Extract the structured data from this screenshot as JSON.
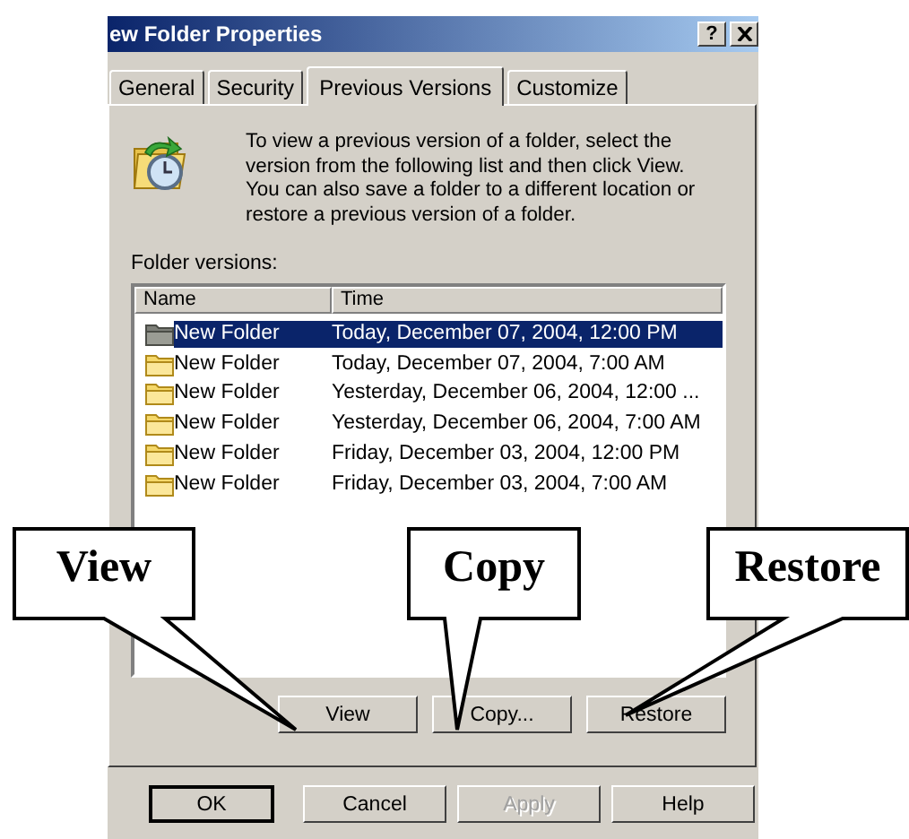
{
  "window": {
    "title": "ew Folder Properties",
    "help_button": "?"
  },
  "tabs": [
    {
      "label": "General",
      "selected": false
    },
    {
      "label": "Security",
      "selected": false
    },
    {
      "label": "Previous Versions",
      "selected": true
    },
    {
      "label": "Customize",
      "selected": false
    }
  ],
  "description": "To view a previous version of a folder, select the version from the following list and then click View. You can also save a folder to a different location or restore a previous version of a folder.",
  "list_label": "Folder versions:",
  "list": {
    "columns": [
      "Name",
      "Time"
    ],
    "rows": [
      {
        "name": "New Folder",
        "time": "Today, December 07, 2004, 12:00 PM",
        "selected": true
      },
      {
        "name": "New Folder",
        "time": "Today, December 07, 2004, 7:00 AM",
        "selected": false
      },
      {
        "name": "New Folder",
        "time": "Yesterday, December 06, 2004, 12:00 ...",
        "selected": false
      },
      {
        "name": "New Folder",
        "time": "Yesterday, December 06, 2004, 7:00 AM",
        "selected": false
      },
      {
        "name": "New Folder",
        "time": "Friday, December 03, 2004, 12:00 PM",
        "selected": false
      },
      {
        "name": "New Folder",
        "time": "Friday, December 03, 2004, 7:00 AM",
        "selected": false
      }
    ]
  },
  "action_buttons": [
    {
      "label": "View"
    },
    {
      "label": "Copy..."
    },
    {
      "label": "Restore"
    }
  ],
  "dialog_buttons": [
    {
      "label": "OK",
      "default": true,
      "disabled": false
    },
    {
      "label": "Cancel",
      "default": false,
      "disabled": false
    },
    {
      "label": "Apply",
      "default": false,
      "disabled": true
    },
    {
      "label": "Help",
      "default": false,
      "disabled": false
    }
  ],
  "callouts": [
    {
      "label": "View"
    },
    {
      "label": "Copy"
    },
    {
      "label": "Restore"
    }
  ]
}
